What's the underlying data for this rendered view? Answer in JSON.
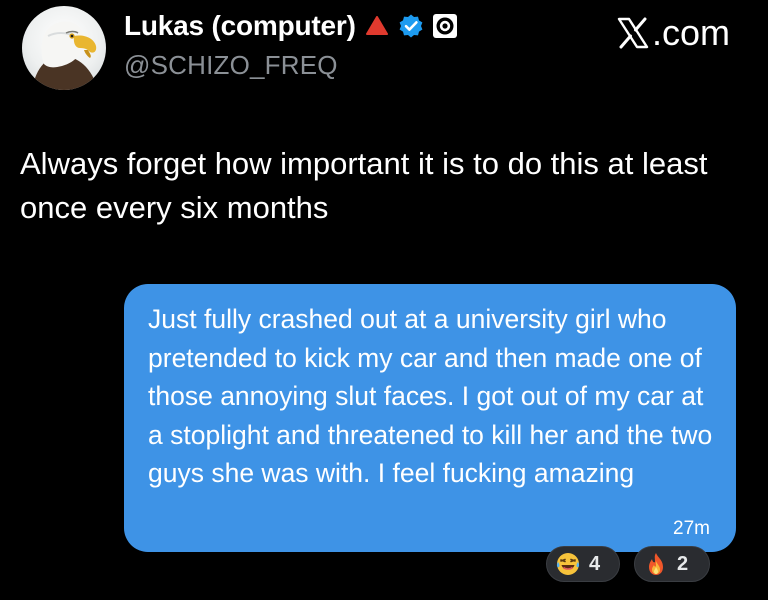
{
  "header": {
    "display_name": "Lukas (computer)",
    "handle": "@SCHIZO_FREQ",
    "brand": ".com",
    "avatar_icon": "eagle-avatar",
    "badges": [
      "red-triangle-icon",
      "verified-check-icon",
      "circle-affiliate-icon"
    ]
  },
  "tweet": {
    "text": "Always forget how important it is to do this at least once every six months"
  },
  "message": {
    "text": "Just fully crashed out at a university girl who pretended to kick my car and then made one of those annoying slut faces. I got out of my car at a stoplight and threatened to kill her and the two guys she was with. I feel fucking amazing",
    "time": "27m",
    "bubble_color": "#3e93e6"
  },
  "reactions": [
    {
      "emoji": "laughing-crying-emoji",
      "count": "4"
    },
    {
      "emoji": "fire-emoji",
      "count": "2"
    }
  ],
  "colors": {
    "background": "#000000",
    "text": "#ffffff",
    "muted": "#8b9096",
    "verified": "#1d9bf0"
  }
}
